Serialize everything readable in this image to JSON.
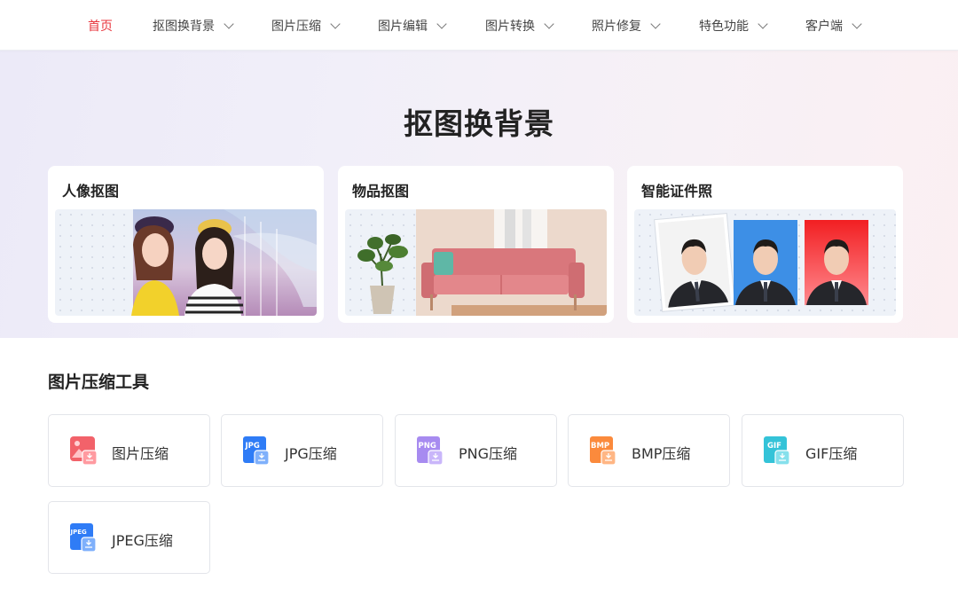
{
  "nav": {
    "items": [
      {
        "label": "首页",
        "active": true,
        "dropdown": false
      },
      {
        "label": "抠图换背景",
        "active": false,
        "dropdown": true
      },
      {
        "label": "图片压缩",
        "active": false,
        "dropdown": true
      },
      {
        "label": "图片编辑",
        "active": false,
        "dropdown": true
      },
      {
        "label": "图片转换",
        "active": false,
        "dropdown": true
      },
      {
        "label": "照片修复",
        "active": false,
        "dropdown": true
      },
      {
        "label": "特色功能",
        "active": false,
        "dropdown": true
      },
      {
        "label": "客户端",
        "active": false,
        "dropdown": true
      }
    ]
  },
  "hero": {
    "title": "抠图换背景",
    "cards": [
      {
        "title": "人像抠图",
        "image": "two-women-portrait"
      },
      {
        "title": "物品抠图",
        "image": "pink-sofa-with-plant"
      },
      {
        "title": "智能证件照",
        "image": "id-photos-white-blue-red"
      }
    ]
  },
  "compress": {
    "title": "图片压缩工具",
    "tools": [
      {
        "label": "图片压缩",
        "icon": "image-compress-icon",
        "badge": "",
        "color": "#f2626a"
      },
      {
        "label": "JPG压缩",
        "icon": "jpg-compress-icon",
        "badge": "JPG",
        "color": "#2f7cf6"
      },
      {
        "label": "PNG压缩",
        "icon": "png-compress-icon",
        "badge": "PNG",
        "color": "#a78bf0"
      },
      {
        "label": "BMP压缩",
        "icon": "bmp-compress-icon",
        "badge": "BMP",
        "color": "#fb8a3c"
      },
      {
        "label": "GIF压缩",
        "icon": "gif-compress-icon",
        "badge": "GIF",
        "color": "#34c3d8"
      },
      {
        "label": "JPEG压缩",
        "icon": "jpeg-compress-icon",
        "badge": "JPEG",
        "color": "#2f7cf6"
      }
    ]
  },
  "colors": {
    "accent": "#e8363d",
    "id_blue": "#3d8fe6",
    "id_red": "#f21f22"
  }
}
